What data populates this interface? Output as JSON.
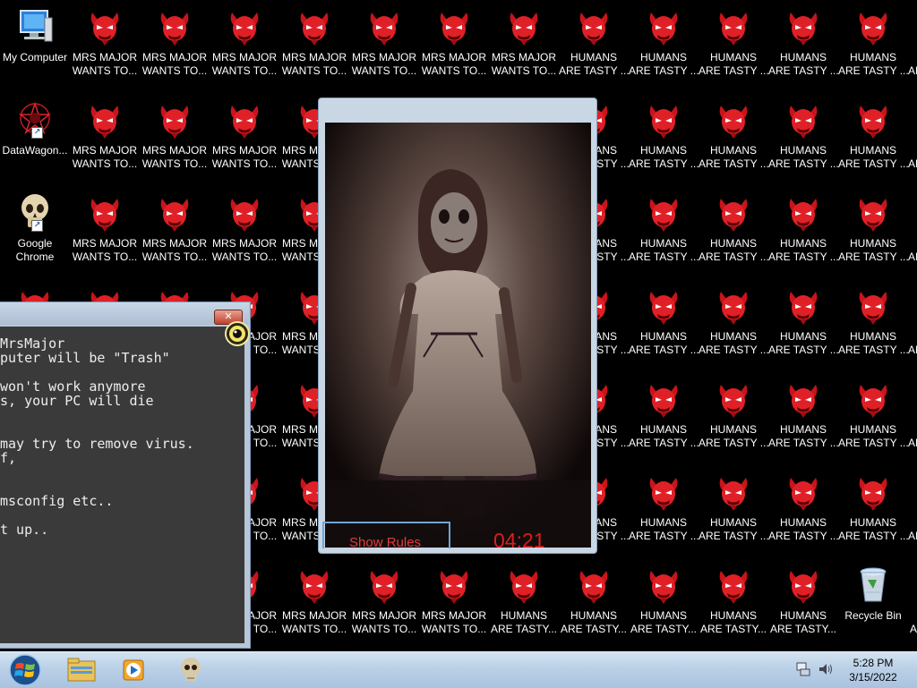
{
  "desktop": {
    "system_icons": [
      {
        "label": "My Computer",
        "icon": "computer-icon"
      },
      {
        "label": "DataWagon...",
        "icon": "datawagon-icon"
      },
      {
        "label": "Google\nChrome",
        "icon": "skull-icon"
      },
      {
        "label": "Recycle Bin",
        "icon": "recycle-bin-icon"
      }
    ],
    "file_labels": {
      "mrs_major": "MRS MAJOR\nWANTS TO...",
      "humans": "HUMANS\nARE TASTY ...",
      "humans_alt": "HUMANS\nARE TASTY..."
    },
    "file_icon": "red-devil-icon"
  },
  "terminal": {
    "close_icon": "close-icon",
    "lines": [
      "MrsMajor",
      "puter will be \"Trash\"",
      "",
      "won't work anymore",
      "s, your PC will die",
      "",
      "",
      "may try to remove virus.",
      "f,",
      "",
      "",
      "msconfig etc..",
      "",
      "t up.."
    ]
  },
  "video": {
    "show_rules": "Show Rules",
    "timer": "04:21"
  },
  "taskbar": {
    "items": [
      "windows-start-icon",
      "explorer-folder-icon",
      "media-player-icon",
      "skull-icon"
    ],
    "tray": [
      "network-icon",
      "volume-icon"
    ],
    "time": "5:28 PM",
    "date": "3/15/2022"
  }
}
